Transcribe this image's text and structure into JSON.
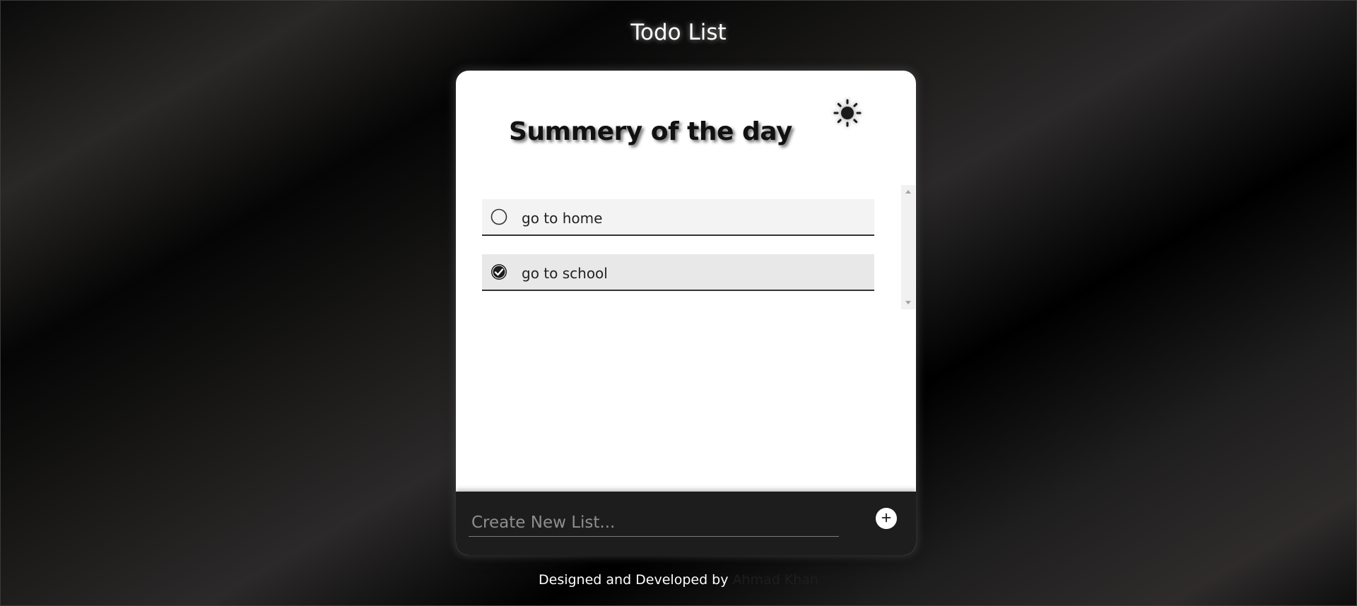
{
  "app": {
    "title": "Todo List"
  },
  "card": {
    "heading": "Summery of the day",
    "theme_toggle_icon": "sun-icon"
  },
  "todos": [
    {
      "text": "go to home",
      "completed": false
    },
    {
      "text": "go to school",
      "completed": true
    }
  ],
  "new_list": {
    "placeholder": "Create New List...",
    "value": "",
    "add_icon": "plus-icon"
  },
  "footer": {
    "credit_text": "Designed and Developed by",
    "author_name": "Ahmad Khan"
  },
  "colors": {
    "card_background": "#ffffff",
    "bottom_bar": "#1d1d1d",
    "text_dark": "#111111",
    "accent_white": "#ffffff"
  }
}
